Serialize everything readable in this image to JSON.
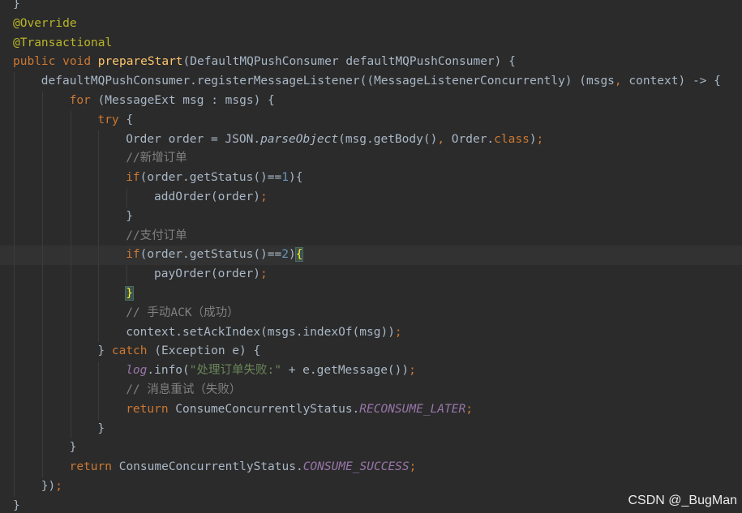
{
  "editor": {
    "colors": {
      "background": "#2b2b2b",
      "current_line": "#323232",
      "indent_guide": "#3b3b3b",
      "keyword": "#cc7832",
      "annotation": "#bbb529",
      "method_declaration": "#ffc66d",
      "identifier": "#a9b7c6",
      "number": "#6897bb",
      "string": "#6a8759",
      "comment": "#808080",
      "static_field": "#9876aa",
      "matched_brace": "#ffef28"
    },
    "current_line": 13,
    "lines": [
      {
        "indent": 0,
        "tokens": [
          [
            "}",
            "plain"
          ]
        ]
      },
      {
        "indent": 0,
        "tokens": [
          [
            "@Override",
            "ann"
          ]
        ]
      },
      {
        "indent": 0,
        "tokens": [
          [
            "@Transactional",
            "ann"
          ]
        ]
      },
      {
        "indent": 0,
        "tokens": [
          [
            "public",
            "kw"
          ],
          [
            " ",
            "plain"
          ],
          [
            "void",
            "kw"
          ],
          [
            " ",
            "plain"
          ],
          [
            "prepareStart",
            "fn"
          ],
          [
            "(DefaultMQPushConsumer defaultMQPushConsumer) {",
            "plain"
          ]
        ]
      },
      {
        "indent": 1,
        "tokens": [
          [
            "defaultMQPushConsumer.registerMessageListener((MessageListenerConcurrently) (msgs",
            "plain"
          ],
          [
            ",",
            "punc"
          ],
          [
            " context) -> {",
            "plain"
          ]
        ]
      },
      {
        "indent": 2,
        "tokens": [
          [
            "for",
            "kw"
          ],
          [
            " (MessageExt msg : msgs) {",
            "plain"
          ]
        ]
      },
      {
        "indent": 3,
        "tokens": [
          [
            "try",
            "kw"
          ],
          [
            " {",
            "plain"
          ]
        ]
      },
      {
        "indent": 4,
        "tokens": [
          [
            "Order order = JSON.",
            "plain"
          ],
          [
            "parseObject",
            "ital"
          ],
          [
            "(msg.getBody()",
            "plain"
          ],
          [
            ",",
            "punc"
          ],
          [
            " Order.",
            "plain"
          ],
          [
            "class",
            "kw"
          ],
          [
            ")",
            "plain"
          ],
          [
            ";",
            "punc"
          ]
        ]
      },
      {
        "indent": 4,
        "tokens": [
          [
            "//新增订单",
            "com"
          ]
        ]
      },
      {
        "indent": 4,
        "tokens": [
          [
            "if",
            "kw"
          ],
          [
            "(order.getStatus()==",
            "plain"
          ],
          [
            "1",
            "num"
          ],
          [
            "){",
            "plain"
          ]
        ]
      },
      {
        "indent": 5,
        "tokens": [
          [
            "addOrder(order)",
            "plain"
          ],
          [
            ";",
            "punc"
          ]
        ]
      },
      {
        "indent": 4,
        "tokens": [
          [
            "}",
            "plain"
          ]
        ]
      },
      {
        "indent": 4,
        "tokens": [
          [
            "//支付订单",
            "com"
          ]
        ]
      },
      {
        "indent": 4,
        "tokens": [
          [
            "if",
            "kw"
          ],
          [
            "(order.getStatus()==",
            "plain"
          ],
          [
            "2",
            "num"
          ],
          [
            ")",
            "plain"
          ],
          [
            "{",
            "brace-hl"
          ]
        ]
      },
      {
        "indent": 5,
        "tokens": [
          [
            "payOrder(order)",
            "plain"
          ],
          [
            ";",
            "punc"
          ]
        ]
      },
      {
        "indent": 4,
        "tokens": [
          [
            "}",
            "brace-hl"
          ]
        ]
      },
      {
        "indent": 4,
        "tokens": [
          [
            "// 手动ACK（成功）",
            "com"
          ]
        ]
      },
      {
        "indent": 4,
        "tokens": [
          [
            "context.setAckIndex(msgs.indexOf(msg))",
            "plain"
          ],
          [
            ";",
            "punc"
          ]
        ]
      },
      {
        "indent": 3,
        "tokens": [
          [
            "} ",
            "plain"
          ],
          [
            "catch",
            "kw"
          ],
          [
            " (Exception e) {",
            "plain"
          ]
        ]
      },
      {
        "indent": 4,
        "tokens": [
          [
            "log",
            "log"
          ],
          [
            ".info(",
            "plain"
          ],
          [
            "\"处理订单失败:\"",
            "str"
          ],
          [
            " + e.getMessage())",
            "plain"
          ],
          [
            ";",
            "punc"
          ]
        ]
      },
      {
        "indent": 4,
        "tokens": [
          [
            "// 消息重试（失败）",
            "com"
          ]
        ]
      },
      {
        "indent": 4,
        "tokens": [
          [
            "return",
            "kw"
          ],
          [
            " ConsumeConcurrentlyStatus.",
            "plain"
          ],
          [
            "RECONSUME_LATER",
            "field"
          ],
          [
            ";",
            "punc"
          ]
        ]
      },
      {
        "indent": 3,
        "tokens": [
          [
            "}",
            "plain"
          ]
        ]
      },
      {
        "indent": 2,
        "tokens": [
          [
            "}",
            "plain"
          ]
        ]
      },
      {
        "indent": 2,
        "tokens": [
          [
            "return",
            "kw"
          ],
          [
            " ConsumeConcurrentlyStatus.",
            "plain"
          ],
          [
            "CONSUME_SUCCESS",
            "field"
          ],
          [
            ";",
            "punc"
          ]
        ]
      },
      {
        "indent": 1,
        "tokens": [
          [
            "})",
            "plain"
          ],
          [
            ";",
            "punc"
          ]
        ]
      },
      {
        "indent": 0,
        "tokens": [
          [
            "}",
            "plain"
          ]
        ]
      }
    ]
  },
  "watermark": "CSDN @_BugMan"
}
